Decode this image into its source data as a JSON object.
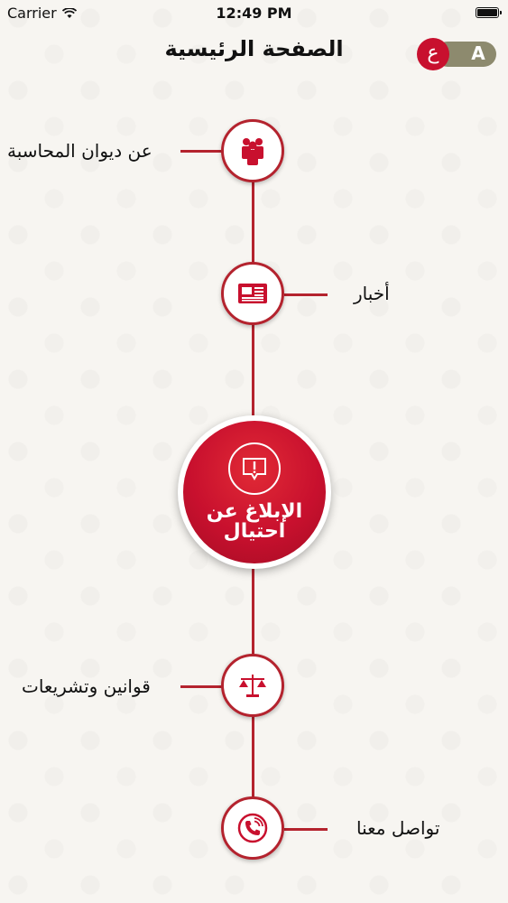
{
  "status_bar": {
    "carrier": "Carrier",
    "time": "12:49 PM"
  },
  "header": {
    "title": "الصفحة الرئيسية"
  },
  "language": {
    "english_label": "A",
    "arabic_label": "ع"
  },
  "menu": {
    "about": "عن ديوان المحاسبة",
    "news": "أخبار",
    "report_fraud_line1": "الإبلاغ عن",
    "report_fraud_line2": "احتيال",
    "laws": "قوانين وتشريعات",
    "contact": "تواصل معنا"
  },
  "colors": {
    "accent": "#c8102e",
    "line": "#b4232e",
    "toggle_bg": "#8d8a6e"
  },
  "icons": [
    "people-icon",
    "newspaper-icon",
    "alert-icon",
    "scales-icon",
    "phone-icon"
  ]
}
